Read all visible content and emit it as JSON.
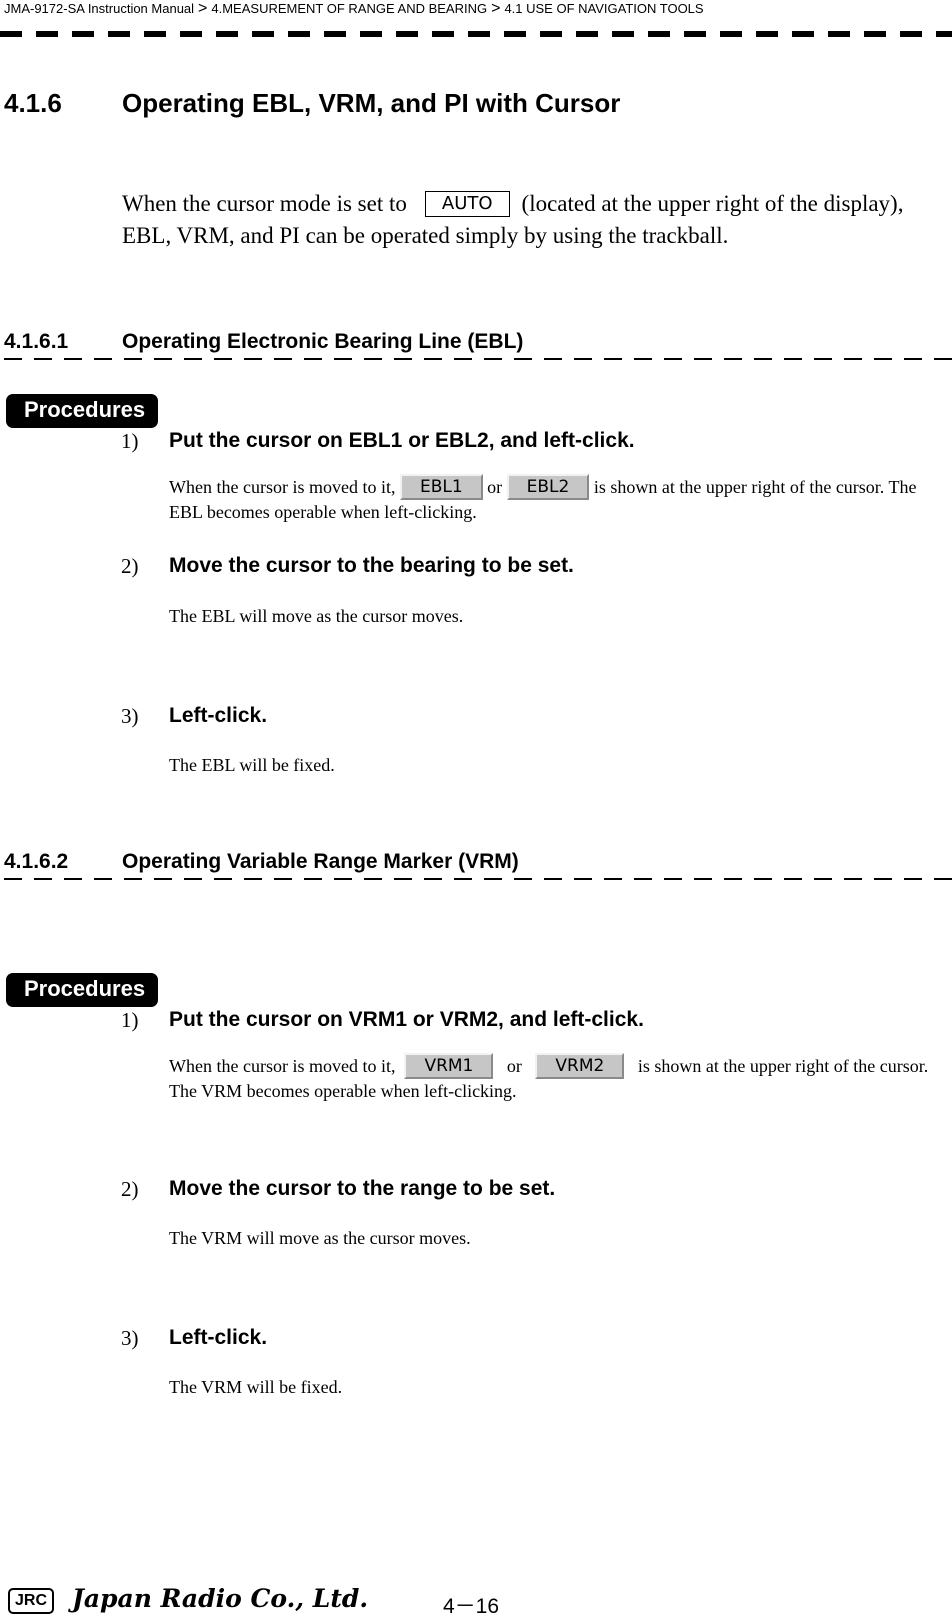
{
  "header": {
    "manual": "JMA-9172-SA Instruction Manual",
    "separator": ">",
    "chapter": "4.MEASUREMENT OF RANGE AND BEARING",
    "section": "4.1  USE OF NAVIGATION TOOLS"
  },
  "section": {
    "number": "4.1.6",
    "title": "Operating EBL, VRM, and PI with Cursor",
    "intro_before": "When the cursor mode is set to",
    "cursor_mode_key": "AUTO",
    "intro_after": "(located at the upper right of the display), EBL, VRM, and PI can be operated simply by using the trackball."
  },
  "subsections": [
    {
      "number": "4.1.6.1",
      "title": "Operating Electronic Bearing Line (EBL)",
      "procedures_label": "Procedures",
      "steps": [
        {
          "n": "1)",
          "title": "Put the cursor on EBL1 or EBL2, and left-click.",
          "text_before": "When the cursor is moved to it,",
          "key1": "EBL1",
          "or": "or",
          "key2": "EBL2",
          "text_after": "is shown at the upper right of the cursor. The EBL becomes operable when left-clicking."
        },
        {
          "n": "2)",
          "title": "Move the cursor to the bearing to be set.",
          "text": "The EBL will move as the cursor moves."
        },
        {
          "n": "3)",
          "title": "Left-click.",
          "text": "The EBL will be fixed."
        }
      ]
    },
    {
      "number": "4.1.6.2",
      "title": "Operating Variable Range Marker (VRM)",
      "procedures_label": "Procedures",
      "steps": [
        {
          "n": "1)",
          "title": "Put the cursor on VRM1 or VRM2, and left-click.",
          "text_before": "When the cursor is moved to it,",
          "key1": "VRM1",
          "or": "or",
          "key2": "VRM2",
          "text_after": "is shown at the upper right of the cursor. The VRM becomes operable when left-clicking."
        },
        {
          "n": "2)",
          "title": "Move the cursor to the range to be set.",
          "text": "The VRM will move as the cursor moves."
        },
        {
          "n": "3)",
          "title": "Left-click.",
          "text": "The VRM will be fixed."
        }
      ]
    }
  ],
  "footer": {
    "logo": "JRC",
    "company": "Japan Radio Co., Ltd.",
    "page": "4－16"
  }
}
